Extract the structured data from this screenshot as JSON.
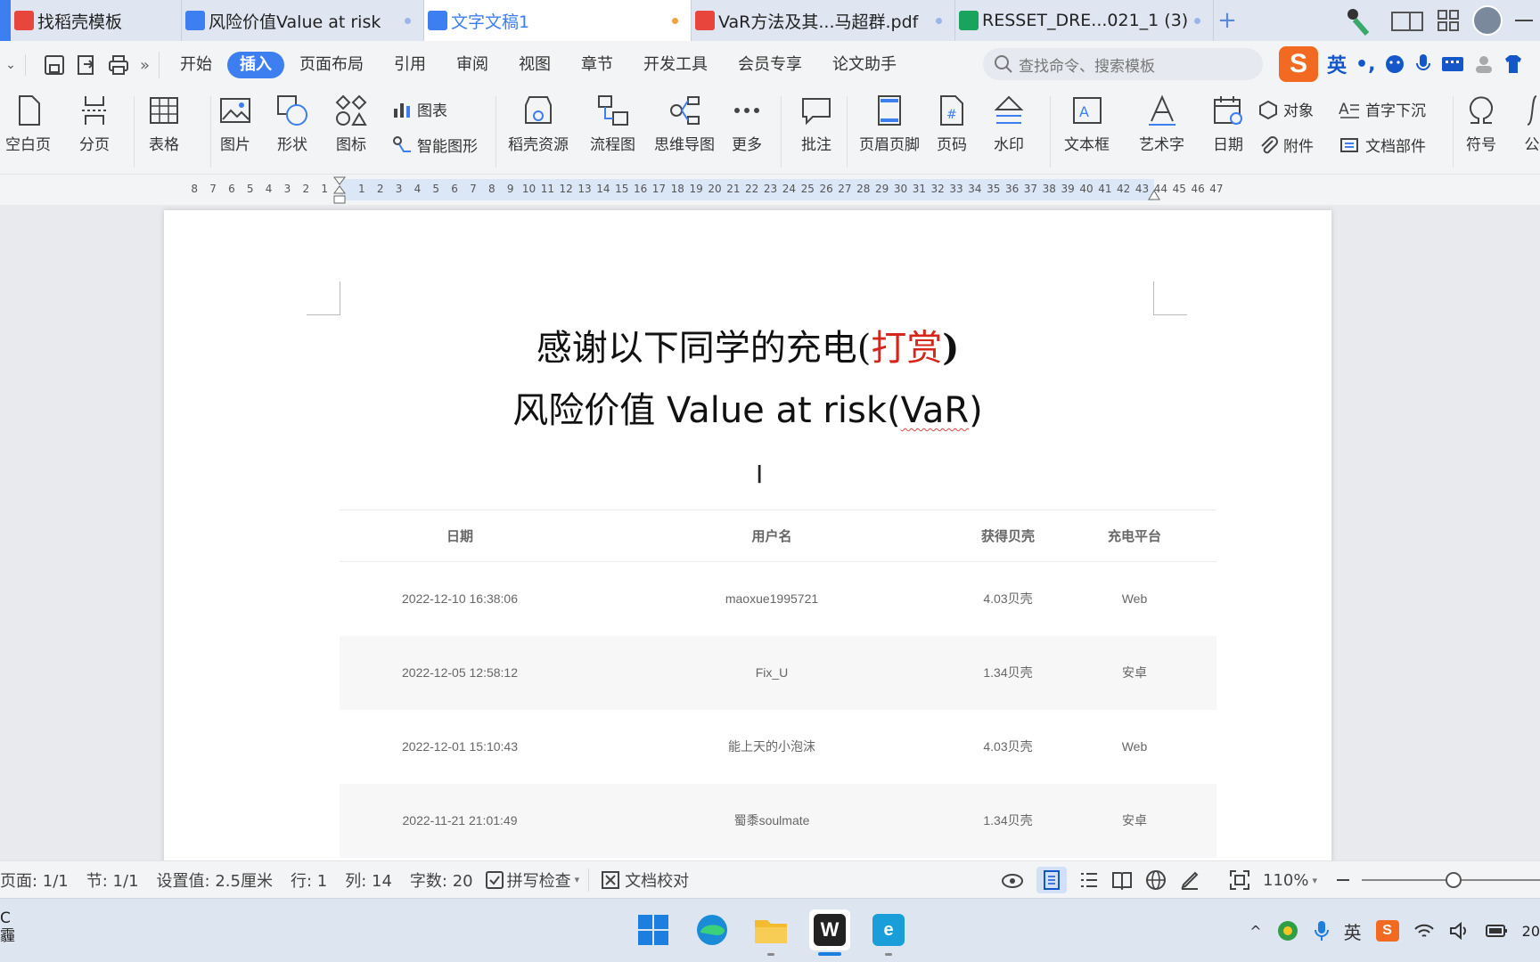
{
  "tabs": [
    {
      "label": "找稻壳模板",
      "color": "#e8453c"
    },
    {
      "label": "风险价值Value at risk",
      "color": "#3d7ff0"
    },
    {
      "label": "文字文稿1",
      "color": "#3d7ff0"
    },
    {
      "label": "VaR方法及其...马超群.pdf",
      "color": "#e8453c"
    },
    {
      "label": "RESSET_DRE...021_1 (3)",
      "color": "#1aa35c"
    }
  ],
  "menu": [
    "开始",
    "插入",
    "页面布局",
    "引用",
    "审阅",
    "视图",
    "章节",
    "开发工具",
    "会员专享",
    "论文助手"
  ],
  "search_placeholder": "查找命令、搜索模板",
  "ime_label": "英",
  "ribbon": {
    "blank_page": "空白页",
    "page_break": "分页",
    "table": "表格",
    "picture": "图片",
    "shape": "形状",
    "icon": "图标",
    "chart": "图表",
    "smart_art": "智能图形",
    "docer_resources": "稻壳资源",
    "flowchart": "流程图",
    "mind_map": "思维导图",
    "more": "更多",
    "comment": "批注",
    "header_footer": "页眉页脚",
    "page_number": "页码",
    "watermark": "水印",
    "text_box": "文本框",
    "word_art": "艺术字",
    "date": "日期",
    "object": "对象",
    "attachment": "附件",
    "drop_cap": "首字下沉",
    "doc_parts": "文档部件",
    "symbol": "符号",
    "formula": "公"
  },
  "ruler": {
    "left": [
      "8",
      "7",
      "6",
      "5",
      "4",
      "3",
      "2",
      "1"
    ],
    "right": [
      "1",
      "2",
      "3",
      "4",
      "5",
      "6",
      "7",
      "8",
      "9",
      "10",
      "11",
      "12",
      "13",
      "14",
      "15",
      "16",
      "17",
      "18",
      "19",
      "20",
      "21",
      "22",
      "23",
      "24",
      "25",
      "26",
      "27",
      "28",
      "29",
      "30",
      "31",
      "32",
      "33",
      "34",
      "35",
      "36",
      "37",
      "38",
      "39",
      "40",
      "41",
      "42",
      "43",
      "44",
      "45",
      "46",
      "47"
    ]
  },
  "doc": {
    "title1_main": "感谢以下同学的充电(",
    "title1_red": "打赏",
    "title1_end": ")",
    "title2_main": "风险价值 Value at risk(",
    "title2_underlined": "VaR",
    "title2_end": ")",
    "table": {
      "headers": [
        "日期",
        "用户名",
        "获得贝壳",
        "充电平台"
      ],
      "rows": [
        [
          "2022-12-10 16:38:06",
          "maoxue1995721",
          "4.03贝壳",
          "Web"
        ],
        [
          "2022-12-05 12:58:12",
          "Fix_U",
          "1.34贝壳",
          "安卓"
        ],
        [
          "2022-12-01 15:10:43",
          "能上天的小泡沫",
          "4.03贝壳",
          "Web"
        ],
        [
          "2022-11-21 21:01:49",
          "蜀黍soulmate",
          "1.34贝壳",
          "安卓"
        ]
      ]
    }
  },
  "status": {
    "page": "页面: 1/1",
    "section": "节: 1/1",
    "setting": "设置值: 2.5厘米",
    "row": "行: 1",
    "col": "列: 14",
    "words": "字数: 20",
    "spell": "拼写检查",
    "proof": "文档校对",
    "zoom": "110%"
  },
  "taskbar": {
    "left1": "C",
    "left2": "霾",
    "ime": "英",
    "clock": "20"
  }
}
